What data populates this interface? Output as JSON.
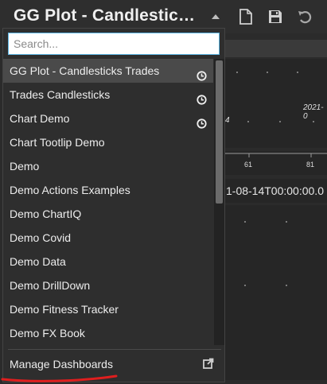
{
  "header": {
    "title": "GG Plot - Candlestic…"
  },
  "background": {
    "date_label_top": "2021-0",
    "date_fragment": "4",
    "axis_ticks": [
      "61",
      "81"
    ],
    "date_text": "1-08-14T00:00:00.0"
  },
  "dropdown": {
    "search_placeholder": "Search...",
    "items": [
      {
        "label": "GG Plot - Candlesticks Trades",
        "recent": true,
        "selected": true
      },
      {
        "label": "Trades Candlesticks",
        "recent": true
      },
      {
        "label": "Chart Demo",
        "recent": true
      },
      {
        "label": "Chart Tootlip Demo"
      },
      {
        "label": "Demo"
      },
      {
        "label": "Demo Actions Examples"
      },
      {
        "label": "Demo ChartIQ"
      },
      {
        "label": "Demo Covid"
      },
      {
        "label": "Demo Data"
      },
      {
        "label": "Demo DrillDown"
      },
      {
        "label": "Demo Fitness Tracker"
      },
      {
        "label": "Demo FX Book"
      }
    ],
    "manage_label": "Manage Dashboards"
  },
  "colors": {
    "annotation_underline": "#e01e1e",
    "search_focus": "#5fb8e6"
  }
}
